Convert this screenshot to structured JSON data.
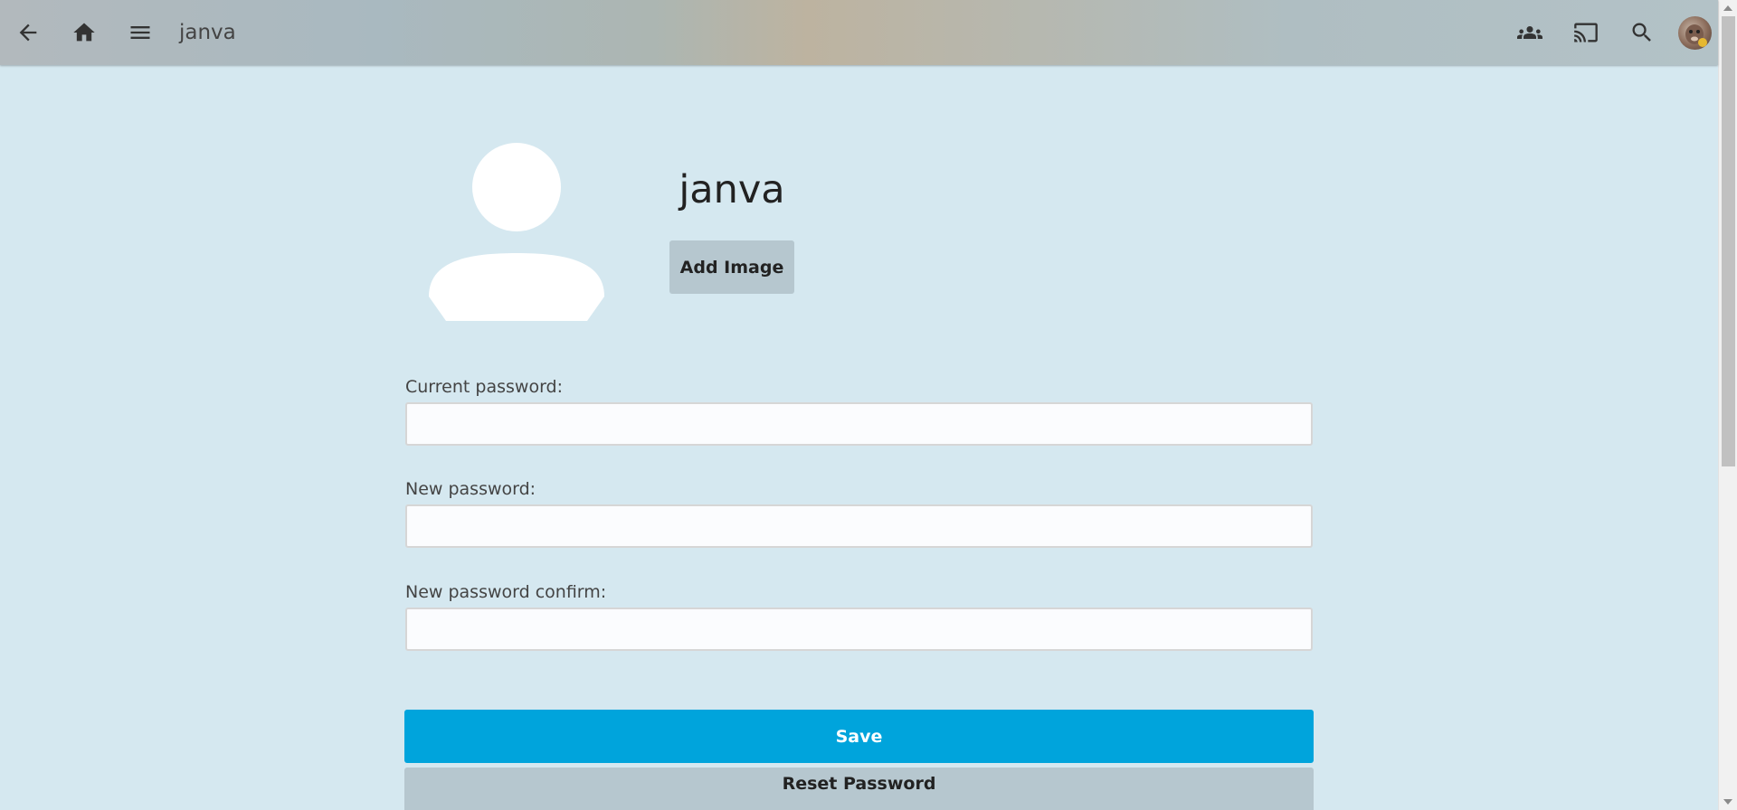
{
  "header": {
    "title": "janva",
    "back_icon": "back-arrow-icon",
    "home_icon": "home-icon",
    "menu_icon": "hamburger-menu-icon",
    "users_icon": "group-users-icon",
    "cast_icon": "cast-icon",
    "search_icon": "search-icon",
    "avatar": "user-avatar"
  },
  "profile": {
    "username": "janva",
    "add_image_label": "Add Image",
    "avatar_icon": "default-user-silhouette-icon"
  },
  "form": {
    "current_password": {
      "label": "Current password:",
      "value": ""
    },
    "new_password": {
      "label": "New password:",
      "value": ""
    },
    "new_password_confirm": {
      "label": "New password confirm:",
      "value": ""
    },
    "save_label": "Save",
    "reset_label": "Reset Password"
  },
  "colors": {
    "page_bg": "#d5e8f0",
    "accent": "#00a4dc",
    "secondary_button": "#b6c7cf"
  }
}
